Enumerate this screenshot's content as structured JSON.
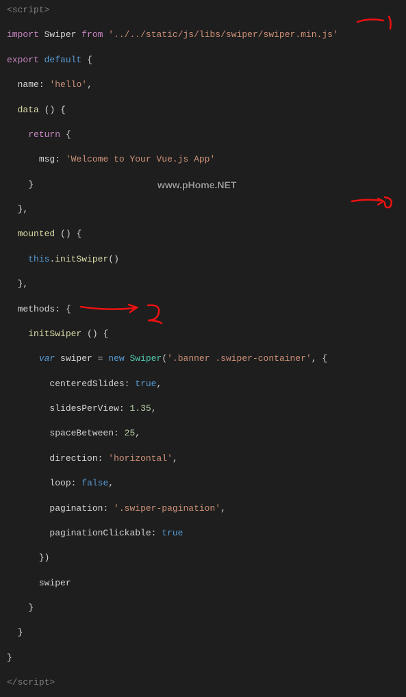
{
  "watermark": "www.pHome.NET",
  "annotations": {
    "one": "1",
    "two": "2",
    "three": "3"
  },
  "code": {
    "l01": {
      "tag_open": "<",
      "tag_name": "script",
      "tag_close": ">"
    },
    "l02": {
      "kw1": "import",
      "ident": "Swiper",
      "kw2": "from",
      "str": "'../../static/js/libs/swiper/swiper.min.js'"
    },
    "l03": {
      "kw1": "export",
      "kw2": "default",
      "punct": "{"
    },
    "l04": {
      "prop": "name",
      "colon": ":",
      "str": "'hello'",
      "comma": ","
    },
    "l05": {
      "prop": "data",
      "paren": "()",
      "brace": "{"
    },
    "l06": {
      "kw": "return",
      "brace": "{"
    },
    "l07": {
      "prop": "msg",
      "colon": ":",
      "str": "'Welcome to Your Vue.js App'"
    },
    "l08": {
      "brace": "}"
    },
    "l09": {
      "brace": "}",
      "comma": ","
    },
    "l10": {
      "prop": "mounted",
      "paren": "()",
      "brace": "{"
    },
    "l11": {
      "kw": "this",
      "dot": ".",
      "func": "initSwiper",
      "paren": "()"
    },
    "l12": {
      "brace": "}",
      "comma": ","
    },
    "l13": {
      "prop": "methods",
      "colon": ":",
      "brace": "{"
    },
    "l14": {
      "func": "initSwiper",
      "paren": "()",
      "brace": "{"
    },
    "l15": {
      "kw1": "var",
      "ident": "swiper",
      "eq": "=",
      "kw2": "new",
      "cls": "Swiper",
      "open": "(",
      "str": "'.banner .swiper-container'",
      "comma": ",",
      "brace": "{"
    },
    "l16": {
      "prop": "centeredSlides",
      "colon": ":",
      "val": "true",
      "comma": ","
    },
    "l17": {
      "prop": "slidesPerView",
      "colon": ":",
      "val": "1.35",
      "comma": ","
    },
    "l18": {
      "prop": "spaceBetween",
      "colon": ":",
      "val": "25",
      "comma": ","
    },
    "l19": {
      "prop": "direction",
      "colon": ":",
      "val": "'horizontal'",
      "comma": ","
    },
    "l20": {
      "prop": "loop",
      "colon": ":",
      "val": "false",
      "comma": ","
    },
    "l21": {
      "prop": "pagination",
      "colon": ":",
      "val": "'.swiper-pagination'",
      "comma": ","
    },
    "l22": {
      "prop": "paginationClickable",
      "colon": ":",
      "val": "true"
    },
    "l23": {
      "brace": "})"
    },
    "l24": {
      "ident": "swiper"
    },
    "l25": {
      "brace": "}"
    },
    "l26": {
      "brace": "}"
    },
    "l27": {
      "brace": "}"
    },
    "l28": {
      "tag_open": "</",
      "tag_name": "script",
      "tag_close": ">"
    }
  }
}
